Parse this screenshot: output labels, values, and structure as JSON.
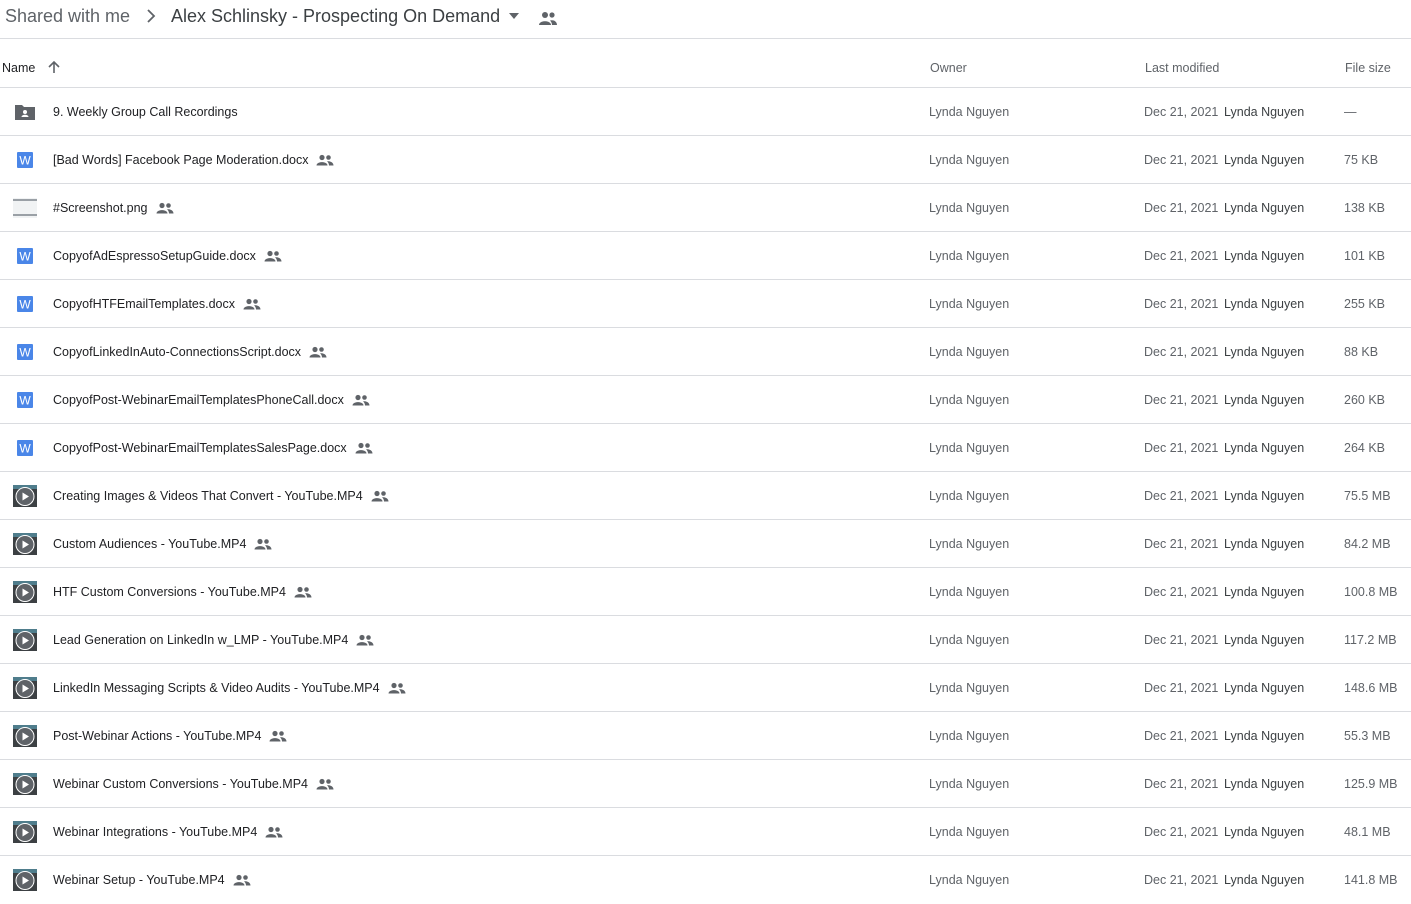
{
  "breadcrumb": {
    "root": "Shared with me",
    "current": "Alex Schlinsky - Prospecting On Demand"
  },
  "columns": {
    "name": "Name",
    "owner": "Owner",
    "last_modified": "Last modified",
    "file_size": "File size"
  },
  "colors": {
    "word_blue": "#4a86e8",
    "folder_gray": "#5f6368",
    "divider": "#dadce0"
  },
  "files": [
    {
      "icon": "shared-folder-icon",
      "type": "folder",
      "name": "9. Weekly Group Call Recordings",
      "shared": false,
      "owner": "Lynda Nguyen",
      "modified": "Dec 21, 2021",
      "modified_by": "Lynda Nguyen",
      "size": "—"
    },
    {
      "icon": "word-doc-icon",
      "type": "word",
      "name": "[Bad Words] Facebook Page Moderation.docx",
      "shared": true,
      "owner": "Lynda Nguyen",
      "modified": "Dec 21, 2021",
      "modified_by": "Lynda Nguyen",
      "size": "75 KB"
    },
    {
      "icon": "image-thumbnail-icon",
      "type": "image",
      "name": "#Screenshot.png",
      "shared": true,
      "owner": "Lynda Nguyen",
      "modified": "Dec 21, 2021",
      "modified_by": "Lynda Nguyen",
      "size": "138 KB"
    },
    {
      "icon": "word-doc-icon",
      "type": "word",
      "name": "CopyofAdEspressoSetupGuide.docx",
      "shared": true,
      "owner": "Lynda Nguyen",
      "modified": "Dec 21, 2021",
      "modified_by": "Lynda Nguyen",
      "size": "101 KB"
    },
    {
      "icon": "word-doc-icon",
      "type": "word",
      "name": "CopyofHTFEmailTemplates.docx",
      "shared": true,
      "owner": "Lynda Nguyen",
      "modified": "Dec 21, 2021",
      "modified_by": "Lynda Nguyen",
      "size": "255 KB"
    },
    {
      "icon": "word-doc-icon",
      "type": "word",
      "name": "CopyofLinkedInAuto-ConnectionsScript.docx",
      "shared": true,
      "owner": "Lynda Nguyen",
      "modified": "Dec 21, 2021",
      "modified_by": "Lynda Nguyen",
      "size": "88 KB"
    },
    {
      "icon": "word-doc-icon",
      "type": "word",
      "name": "CopyofPost-WebinarEmailTemplatesPhoneCall.docx",
      "shared": true,
      "owner": "Lynda Nguyen",
      "modified": "Dec 21, 2021",
      "modified_by": "Lynda Nguyen",
      "size": "260 KB"
    },
    {
      "icon": "word-doc-icon",
      "type": "word",
      "name": "CopyofPost-WebinarEmailTemplatesSalesPage.docx",
      "shared": true,
      "owner": "Lynda Nguyen",
      "modified": "Dec 21, 2021",
      "modified_by": "Lynda Nguyen",
      "size": "264 KB"
    },
    {
      "icon": "video-thumbnail-icon",
      "type": "video",
      "name": "Creating Images & Videos That Convert - YouTube.MP4",
      "shared": true,
      "owner": "Lynda Nguyen",
      "modified": "Dec 21, 2021",
      "modified_by": "Lynda Nguyen",
      "size": "75.5 MB"
    },
    {
      "icon": "video-thumbnail-icon",
      "type": "video",
      "name": "Custom Audiences - YouTube.MP4",
      "shared": true,
      "owner": "Lynda Nguyen",
      "modified": "Dec 21, 2021",
      "modified_by": "Lynda Nguyen",
      "size": "84.2 MB"
    },
    {
      "icon": "video-thumbnail-icon",
      "type": "video",
      "name": "HTF Custom Conversions - YouTube.MP4",
      "shared": true,
      "owner": "Lynda Nguyen",
      "modified": "Dec 21, 2021",
      "modified_by": "Lynda Nguyen",
      "size": "100.8 MB"
    },
    {
      "icon": "video-thumbnail-icon",
      "type": "video",
      "name": "Lead Generation on LinkedIn w_LMP - YouTube.MP4",
      "shared": true,
      "owner": "Lynda Nguyen",
      "modified": "Dec 21, 2021",
      "modified_by": "Lynda Nguyen",
      "size": "117.2 MB"
    },
    {
      "icon": "video-thumbnail-icon",
      "type": "video",
      "name": "LinkedIn Messaging Scripts & Video Audits - YouTube.MP4",
      "shared": true,
      "owner": "Lynda Nguyen",
      "modified": "Dec 21, 2021",
      "modified_by": "Lynda Nguyen",
      "size": "148.6 MB"
    },
    {
      "icon": "video-thumbnail-icon",
      "type": "video",
      "name": "Post-Webinar Actions - YouTube.MP4",
      "shared": true,
      "owner": "Lynda Nguyen",
      "modified": "Dec 21, 2021",
      "modified_by": "Lynda Nguyen",
      "size": "55.3 MB"
    },
    {
      "icon": "video-thumbnail-icon",
      "type": "video",
      "name": "Webinar Custom Conversions - YouTube.MP4",
      "shared": true,
      "owner": "Lynda Nguyen",
      "modified": "Dec 21, 2021",
      "modified_by": "Lynda Nguyen",
      "size": "125.9 MB"
    },
    {
      "icon": "video-thumbnail-icon",
      "type": "video",
      "name": "Webinar Integrations - YouTube.MP4",
      "shared": true,
      "owner": "Lynda Nguyen",
      "modified": "Dec 21, 2021",
      "modified_by": "Lynda Nguyen",
      "size": "48.1 MB"
    },
    {
      "icon": "video-thumbnail-icon",
      "type": "video",
      "name": "Webinar Setup - YouTube.MP4",
      "shared": true,
      "owner": "Lynda Nguyen",
      "modified": "Dec 21, 2021",
      "modified_by": "Lynda Nguyen",
      "size": "141.8 MB"
    }
  ]
}
